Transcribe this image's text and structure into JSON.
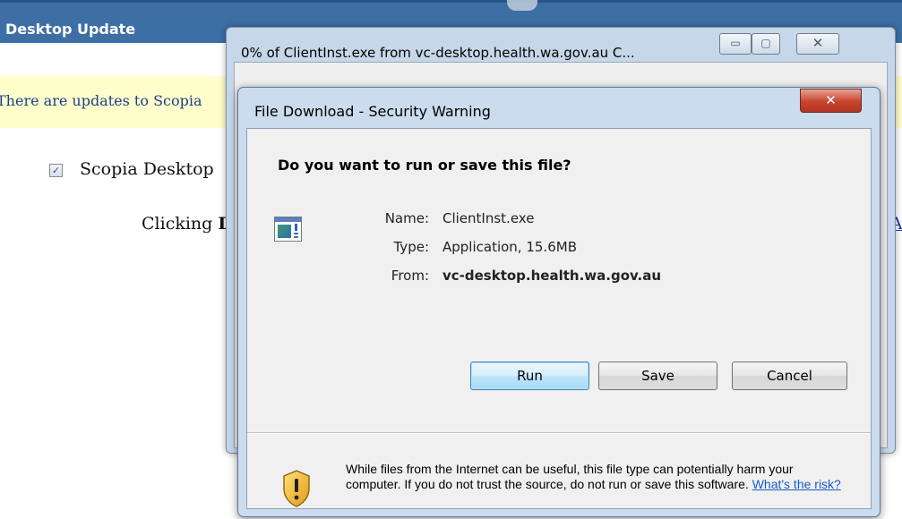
{
  "background_page": {
    "header_title": "Desktop Update",
    "banner_text": "There are updates to Scopia",
    "checkbox_label": "Scopia Desktop",
    "checkbox_mark": "✓",
    "clicking_text": "Clicking ",
    "clicking_bold": "D",
    "right_link": "A"
  },
  "progress_window": {
    "title": "0% of ClientInst.exe from vc-desktop.health.wa.gov.au C...",
    "min_glyph": "▭",
    "max_glyph": "▢",
    "close_glyph": "✕"
  },
  "security_dialog": {
    "title": "File Download - Security Warning",
    "close_glyph": "✕",
    "question": "Do you want to run or save this file?",
    "icon": "application-icon",
    "fields": {
      "name_label": "Name:",
      "name_value": "ClientInst.exe",
      "type_label": "Type:",
      "type_value": "Application, 15.6MB",
      "from_label": "From:",
      "from_value": "vc-desktop.health.wa.gov.au"
    },
    "buttons": {
      "run": "Run",
      "save": "Save",
      "cancel": "Cancel"
    },
    "warning_icon": "shield-warning-icon",
    "warning_text": "While files from the Internet can be useful, this file type can potentially harm your computer. If you do not trust the source, do not run or save this software. ",
    "risk_link": "What's the risk?"
  },
  "colors": {
    "header_blue": "#3d6fa5",
    "banner_yellow": "#ffffcc",
    "dialog_frame": "#cbdcee",
    "close_red": "#c7432c",
    "link_blue": "#1a5bc9"
  }
}
